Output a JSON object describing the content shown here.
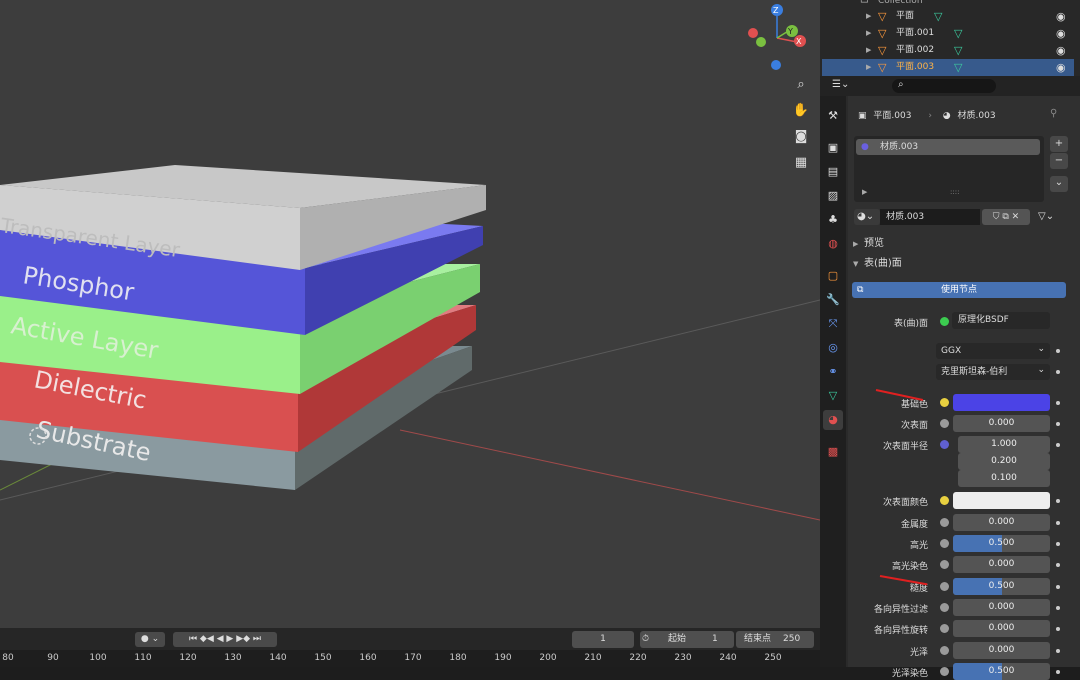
{
  "viewport": {
    "layers": [
      "Transparent Layer",
      "Phosphor",
      "Active Layer",
      "Dielectric",
      "Substrate"
    ],
    "gizmo": {
      "x": "X",
      "y": "Y",
      "z": "Z"
    }
  },
  "timeline": {
    "current": "1",
    "start_label": "起始",
    "start": "1",
    "end_label": "结束点",
    "end": "250",
    "ticks": [
      "80",
      "90",
      "100",
      "110",
      "120",
      "130",
      "140",
      "150",
      "160",
      "170",
      "180",
      "190",
      "200",
      "210",
      "220",
      "230",
      "240",
      "250"
    ]
  },
  "outliner": {
    "collection": "Collection",
    "items": [
      {
        "name": "平面"
      },
      {
        "name": "平面.001"
      },
      {
        "name": "平面.002"
      },
      {
        "name": "平面.003"
      }
    ]
  },
  "properties": {
    "breadcrumb_object": "平面.003",
    "breadcrumb_material": "材质.003",
    "slot": "材质.003",
    "material_name": "材质.003",
    "preview_label": "预览",
    "surface_label": "表(曲)面",
    "use_nodes": "使用节点",
    "surface_field_label": "表(曲)面",
    "surface_shader": "原理化BSDF",
    "distribution": "GGX",
    "subsurface_method": "克里斯坦森-伯利",
    "rows": [
      {
        "label": "基础色",
        "value": ""
      },
      {
        "label": "次表面",
        "value": "0.000"
      },
      {
        "label": "次表面半径",
        "value": "1.000"
      },
      {
        "label": "",
        "value": "0.200"
      },
      {
        "label": "",
        "value": "0.100"
      },
      {
        "label": "次表面颜色",
        "value": ""
      },
      {
        "label": "金属度",
        "value": "0.000"
      },
      {
        "label": "高光",
        "value": "0.500",
        "fraction": 0.5
      },
      {
        "label": "高光染色",
        "value": "0.000"
      },
      {
        "label": "糙度",
        "value": "0.500",
        "fraction": 0.5
      },
      {
        "label": "各向异性过滤",
        "value": "0.000"
      },
      {
        "label": "各向异性旋转",
        "value": "0.000"
      },
      {
        "label": "光泽",
        "value": "0.000"
      },
      {
        "label": "光泽染色",
        "value": "0.500",
        "fraction": 0.5
      }
    ],
    "base_color": "#4b43e6",
    "subsurface_color": "#eeeeee"
  }
}
